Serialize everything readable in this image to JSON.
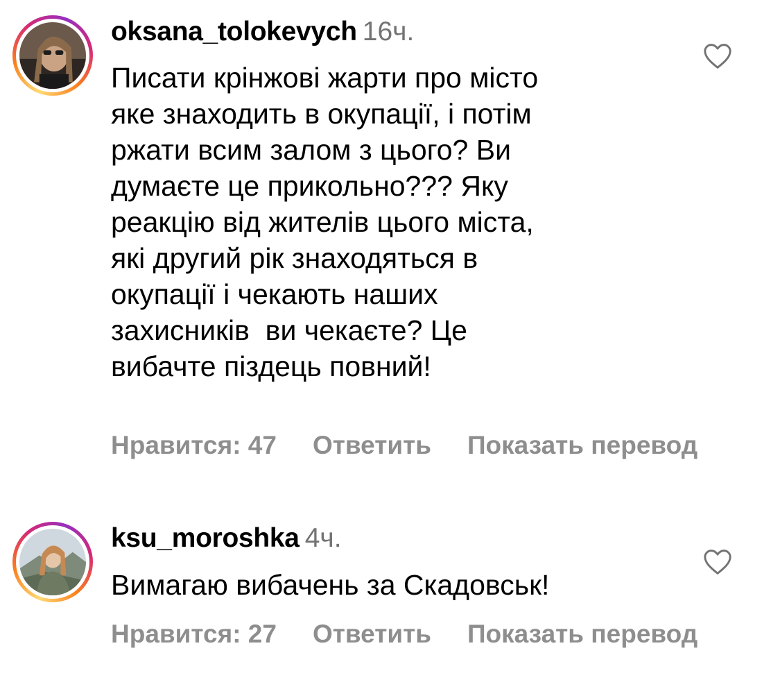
{
  "comments": [
    {
      "username": "oksana_tolokevych",
      "time": "16ч.",
      "lines": [
        "Писати крінжові жарти про місто",
        "яке знаходить в окупації, і потім",
        "ржати всим залом з цього? Ви",
        "думаєте це прикольно??? Яку",
        "реакцію від жителів цього міста,",
        "які другий рік знаходяться в",
        "окупації і чекають наших",
        "захисників  ви чекаєте? Це",
        "вибачте піздець повний!"
      ],
      "likes_label": "Нравится: 47",
      "reply_label": "Ответить",
      "translate_label": "Показать перевод",
      "like_icon": "heart-outline-icon"
    },
    {
      "username": "ksu_moroshka",
      "time": "4ч.",
      "lines": [
        "Вимагаю вибачень за Скадовськ!"
      ],
      "likes_label": "Нравится: 27",
      "reply_label": "Ответить",
      "translate_label": "Показать перевод",
      "like_icon": "heart-outline-icon"
    }
  ],
  "colors": {
    "primary_text": "#000000",
    "secondary_text": "#737373",
    "action_text": "#8e8e8e",
    "story_ring": [
      "#feda75",
      "#fa7e1e",
      "#d62976",
      "#962fbf"
    ]
  }
}
